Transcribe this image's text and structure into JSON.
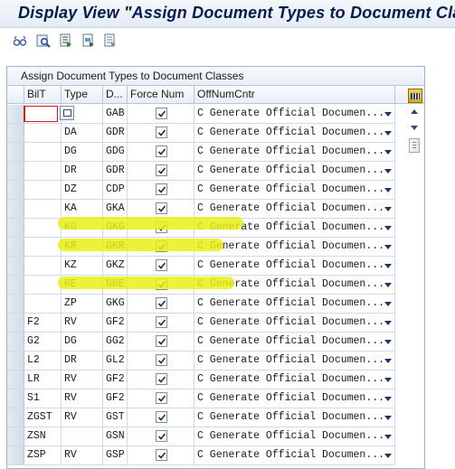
{
  "window": {
    "title": "Display View \"Assign Document Types to Document Clas"
  },
  "toolbar": {
    "icons": [
      "glasses-icon",
      "find-icon",
      "select-all-icon",
      "select-block-icon",
      "deselect-all-icon"
    ]
  },
  "panel": {
    "title": "Assign Document Types to Document Classes",
    "columns": [
      "BilT",
      "Type",
      "D...",
      "Force Num",
      "OffNumCntr"
    ]
  },
  "rows": [
    {
      "bilt": "",
      "type": "",
      "doc": "GAB",
      "force": true,
      "offnum": "C Generate Official Documen..."
    },
    {
      "bilt": "",
      "type": "DA",
      "doc": "GDR",
      "force": true,
      "offnum": "C Generate Official Documen..."
    },
    {
      "bilt": "",
      "type": "DG",
      "doc": "GDG",
      "force": true,
      "offnum": "C Generate Official Documen..."
    },
    {
      "bilt": "",
      "type": "DR",
      "doc": "GDR",
      "force": true,
      "offnum": "C Generate Official Documen..."
    },
    {
      "bilt": "",
      "type": "DZ",
      "doc": "CDP",
      "force": true,
      "offnum": "C Generate Official Documen..."
    },
    {
      "bilt": "",
      "type": "KA",
      "doc": "GKA",
      "force": true,
      "offnum": "C Generate Official Documen..."
    },
    {
      "bilt": "",
      "type": "KG",
      "doc": "GKG",
      "force": true,
      "offnum": "C Generate Official Documen..."
    },
    {
      "bilt": "",
      "type": "KR",
      "doc": "GKR",
      "force": true,
      "offnum": "C Generate Official Documen..."
    },
    {
      "bilt": "",
      "type": "KZ",
      "doc": "GKZ",
      "force": true,
      "offnum": "C Generate Official Documen..."
    },
    {
      "bilt": "",
      "type": "RE",
      "doc": "GRE",
      "force": true,
      "offnum": "C Generate Official Documen..."
    },
    {
      "bilt": "",
      "type": "ZP",
      "doc": "GKG",
      "force": true,
      "offnum": "C Generate Official Documen..."
    },
    {
      "bilt": "F2",
      "type": "RV",
      "doc": "GF2",
      "force": true,
      "offnum": "C Generate Official Documen..."
    },
    {
      "bilt": "G2",
      "type": "DG",
      "doc": "GG2",
      "force": true,
      "offnum": "C Generate Official Documen..."
    },
    {
      "bilt": "L2",
      "type": "DR",
      "doc": "GL2",
      "force": true,
      "offnum": "C Generate Official Documen..."
    },
    {
      "bilt": "LR",
      "type": "RV",
      "doc": "GF2",
      "force": true,
      "offnum": "C Generate Official Documen..."
    },
    {
      "bilt": "S1",
      "type": "RV",
      "doc": "GF2",
      "force": true,
      "offnum": "C Generate Official Documen..."
    },
    {
      "bilt": "ZGST",
      "type": "RV",
      "doc": "GST",
      "force": true,
      "offnum": "C Generate Official Documen..."
    },
    {
      "bilt": "ZSN",
      "type": "",
      "doc": "GSN",
      "force": true,
      "offnum": "C Generate Official Documen..."
    },
    {
      "bilt": "ZSP",
      "type": "RV",
      "doc": "GSP",
      "force": true,
      "offnum": "C Generate Official Documen..."
    }
  ],
  "colors": {
    "title_text": "#0a1a4f",
    "highlight": "#e8f014",
    "input_error": "#d81a1a"
  }
}
